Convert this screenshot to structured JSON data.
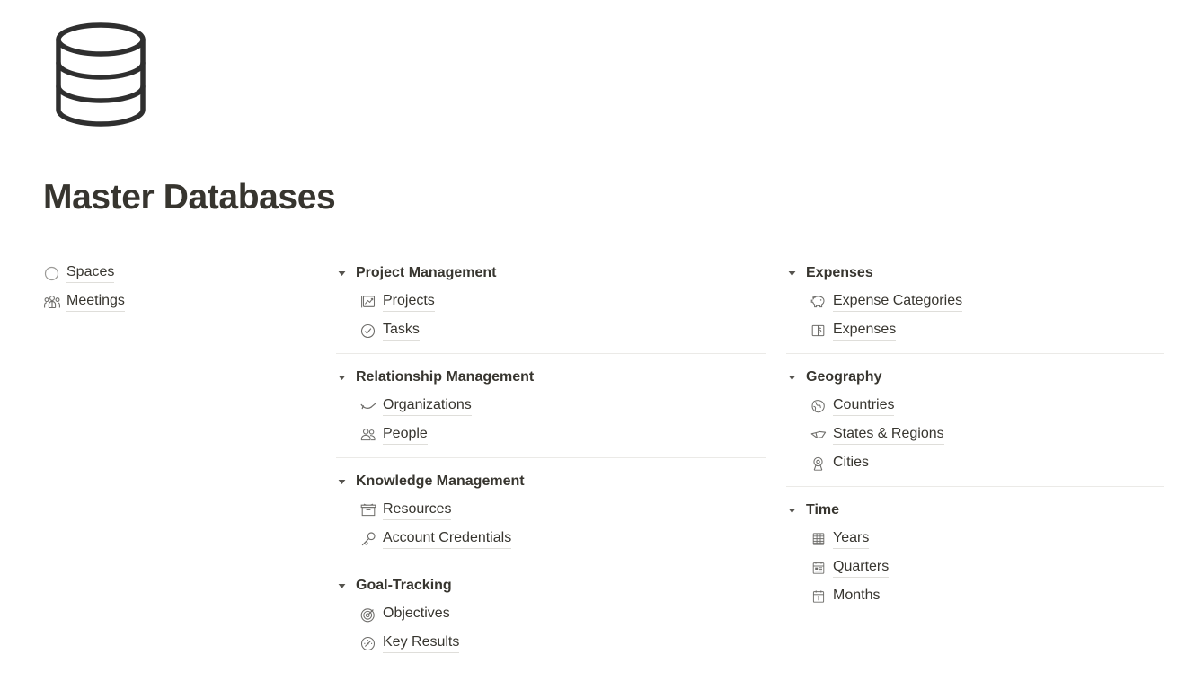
{
  "page": {
    "icon": "database-cylinder-icon",
    "title": "Master Databases",
    "background_color": "#ffffff",
    "text_color": "#37352f",
    "divider_color": "#ebeae7",
    "underline_color": "#dfdeda"
  },
  "columns": [
    {
      "id": "column-left",
      "type": "links",
      "links": [
        {
          "label": "Spaces",
          "icon": "circle-icon"
        },
        {
          "label": "Meetings",
          "icon": "people-group-icon"
        }
      ]
    },
    {
      "id": "column-middle",
      "type": "toggle-groups",
      "groups": [
        {
          "title": "Project Management",
          "expanded": true,
          "caret": "chevron-down-icon",
          "items": [
            {
              "label": "Projects",
              "icon": "chart-frame-icon"
            },
            {
              "label": "Tasks",
              "icon": "check-circle-icon"
            }
          ]
        },
        {
          "title": "Relationship Management",
          "expanded": true,
          "caret": "chevron-down-icon",
          "items": [
            {
              "label": "Organizations",
              "icon": "handshake-swoosh-icon"
            },
            {
              "label": "People",
              "icon": "two-people-icon"
            }
          ]
        },
        {
          "title": "Knowledge Management",
          "expanded": true,
          "caret": "chevron-down-icon",
          "items": [
            {
              "label": "Resources",
              "icon": "archive-box-icon"
            },
            {
              "label": "Account Credentials",
              "icon": "key-icon"
            }
          ]
        },
        {
          "title": "Goal-Tracking",
          "expanded": true,
          "caret": "chevron-down-icon",
          "items": [
            {
              "label": "Objectives",
              "icon": "target-bullseye-icon"
            },
            {
              "label": "Key Results",
              "icon": "gauge-icon"
            }
          ]
        }
      ]
    },
    {
      "id": "column-right",
      "type": "toggle-groups",
      "groups": [
        {
          "title": "Expenses",
          "expanded": true,
          "caret": "chevron-down-icon",
          "items": [
            {
              "label": "Expense Categories",
              "icon": "piggy-bank-icon"
            },
            {
              "label": "Expenses",
              "icon": "banknote-icon"
            }
          ]
        },
        {
          "title": "Geography",
          "expanded": true,
          "caret": "chevron-down-icon",
          "items": [
            {
              "label": "Countries",
              "icon": "globe-map-icon"
            },
            {
              "label": "States & Regions",
              "icon": "region-shape-icon"
            },
            {
              "label": "Cities",
              "icon": "map-pin-icon"
            }
          ]
        },
        {
          "title": "Time",
          "expanded": true,
          "caret": "chevron-down-icon",
          "items": [
            {
              "label": "Years",
              "icon": "table-grid-icon"
            },
            {
              "label": "Quarters",
              "icon": "calendar-quarter-icon"
            },
            {
              "label": "Months",
              "icon": "calendar-month-icon"
            }
          ]
        }
      ]
    }
  ]
}
